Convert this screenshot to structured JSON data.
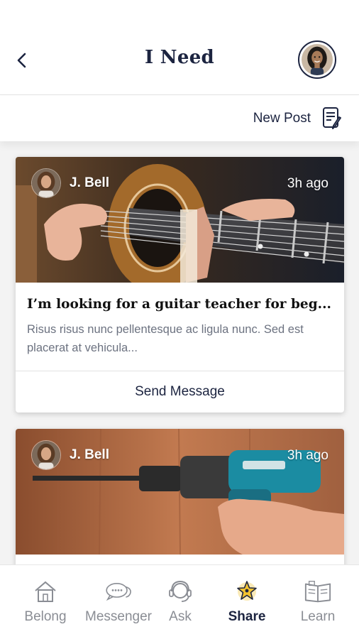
{
  "header": {
    "title": "I Need",
    "back_icon": "chevron-left-icon",
    "avatar_icon": "user-avatar"
  },
  "toolbar": {
    "new_post_label": "New Post",
    "new_post_icon": "edit-document-icon"
  },
  "posts": [
    {
      "author": "J. Bell",
      "time": "3h ago",
      "image": "guitar-photo",
      "title": "I’m looking for a guitar teacher for beg...",
      "description": "Risus risus nunc pellentesque ac ligula nunc. Sed est placerat at vehicula...",
      "action_label": "Send Message"
    },
    {
      "author": "J. Bell",
      "time": "3h ago",
      "image": "power-drill-photo"
    }
  ],
  "tabs": [
    {
      "label": "Belong",
      "icon": "house-icon",
      "active": false
    },
    {
      "label": "Messenger",
      "icon": "chat-bubbles-icon",
      "active": false
    },
    {
      "label": "Ask",
      "icon": "headset-icon",
      "active": false
    },
    {
      "label": "Share",
      "icon": "share-star-icon",
      "active": true
    },
    {
      "label": "Learn",
      "icon": "book-icon",
      "active": false
    }
  ],
  "colors": {
    "primary_text": "#1c2440",
    "muted_text": "#8a8d94",
    "feed_background": "#f3f3f3",
    "active_icon": "#f2c230"
  }
}
